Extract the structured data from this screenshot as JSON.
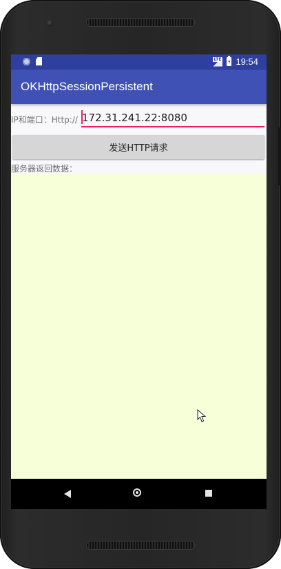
{
  "status_bar": {
    "time": "19:54",
    "network_label": "LTE",
    "icons": [
      "circle-notification-icon",
      "sd-card-icon",
      "lte-signal-icon",
      "battery-charging-icon"
    ]
  },
  "app_bar": {
    "title": "OKHttpSessionPersistent"
  },
  "form": {
    "ip_label": "IP和端口：Http://",
    "ip_value": "172.31.241.22:8080",
    "send_button_label": "发送HTTP请求",
    "response_label": "服务器返回数据：",
    "response_text": ""
  },
  "nav_bar": {
    "icons": [
      "back-icon",
      "home-icon",
      "recents-icon"
    ]
  },
  "colors": {
    "status_bar": "#2f3f9f",
    "app_bar": "#3f51b5",
    "accent": "#e91e63",
    "response_background": "#f7ffd8",
    "button": "#d6d6d6"
  }
}
